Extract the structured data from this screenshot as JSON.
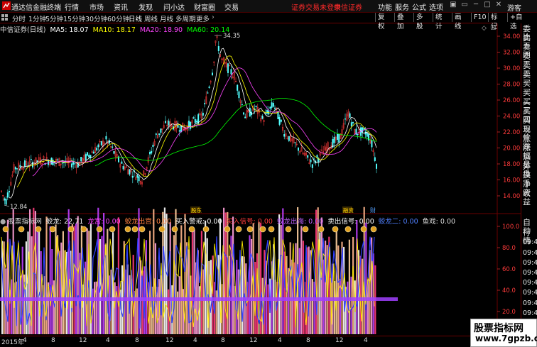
{
  "app": {
    "title": "通达信金融终端",
    "login_status": "证券交易未登录",
    "broker": "中信证券"
  },
  "top_menu": [
    "行情",
    "市场",
    "资讯",
    "发现",
    "问小达",
    "财富圈",
    "交易"
  ],
  "right_menu": [
    "功能",
    "服务",
    "公式",
    "选项"
  ],
  "period_tabs": [
    "分时",
    "1分钟",
    "5分钟",
    "15分钟",
    "30分钟",
    "60分钟",
    "日线",
    "周线",
    "月线",
    "多周期",
    "更多"
  ],
  "period_active_index": 6,
  "toolbar": [
    "复权",
    "叠加",
    "多股",
    "统计",
    "画线",
    "F10",
    "标记",
    "+自选"
  ],
  "guest": "游客",
  "ma_legend": {
    "stock": "中信证券(日线)",
    "ma5": "MA5: 18.07",
    "ma10": "MA10: 18.17",
    "ma20": "MA20: 18.90",
    "ma60": "MA60: 20.14"
  },
  "price_axis": [
    "34.00",
    "32.00",
    "30.00",
    "28.00",
    "26.00",
    "24.00",
    "22.00",
    "20.00",
    "18.00",
    "16.00",
    "14.00"
  ],
  "max_label": "34.35",
  "min_label": "12.84",
  "event_marks": [
    "股东",
    "融资",
    "财"
  ],
  "indicator_axis": [
    "100.0",
    "80.0",
    "60.0",
    "40.0",
    "20.0",
    "0.00"
  ],
  "indicator_legend": {
    "name": "股票指标网",
    "jiaolong": "蛟龙: 22.71",
    "longgong": "龙宫: 0.00",
    "chuhai": "蛟龙出宫: 0.00",
    "buywarn": "买入警戒: 0.00",
    "buysignal": "买入信号: 0.00",
    "chuhai2": "蛟龙出海: 0.00",
    "sellsignal": "卖出信号: 0.00",
    "jiaolong2": "蛟龙二: 0.00",
    "end": "鱼戏: 0.00"
  },
  "right_panel": [
    "委比",
    "卖五",
    "卖四",
    "卖三",
    "卖二",
    "卖一",
    "买一",
    "买二",
    "买三",
    "买四",
    "买五",
    "现价",
    "涨跌",
    "涨幅",
    "总量",
    "外盘",
    "换手",
    "净资",
    "收益"
  ],
  "right_panel_bottom": [
    "自动",
    "行情",
    "09:47",
    "09:47",
    "09:47",
    "09:47",
    "09:47",
    "09:47",
    "09:47",
    "09:47",
    "09:47"
  ],
  "x_axis": [
    "2015年",
    "4",
    "8",
    "12",
    "4",
    "8",
    "12",
    "4",
    "8",
    "12",
    "4",
    "8",
    "12",
    "4",
    "8",
    "12",
    "4"
  ],
  "watermark": {
    "line1": "股票指标网",
    "line2": "www.7gpzb.com"
  },
  "colors": {
    "up": "#ff3b3b",
    "down": "#54ffff",
    "ma5": "#ffffff",
    "ma10": "#ffff00",
    "ma20": "#ff44ff",
    "ma60": "#00ff00",
    "grid": "#6a0000"
  }
}
